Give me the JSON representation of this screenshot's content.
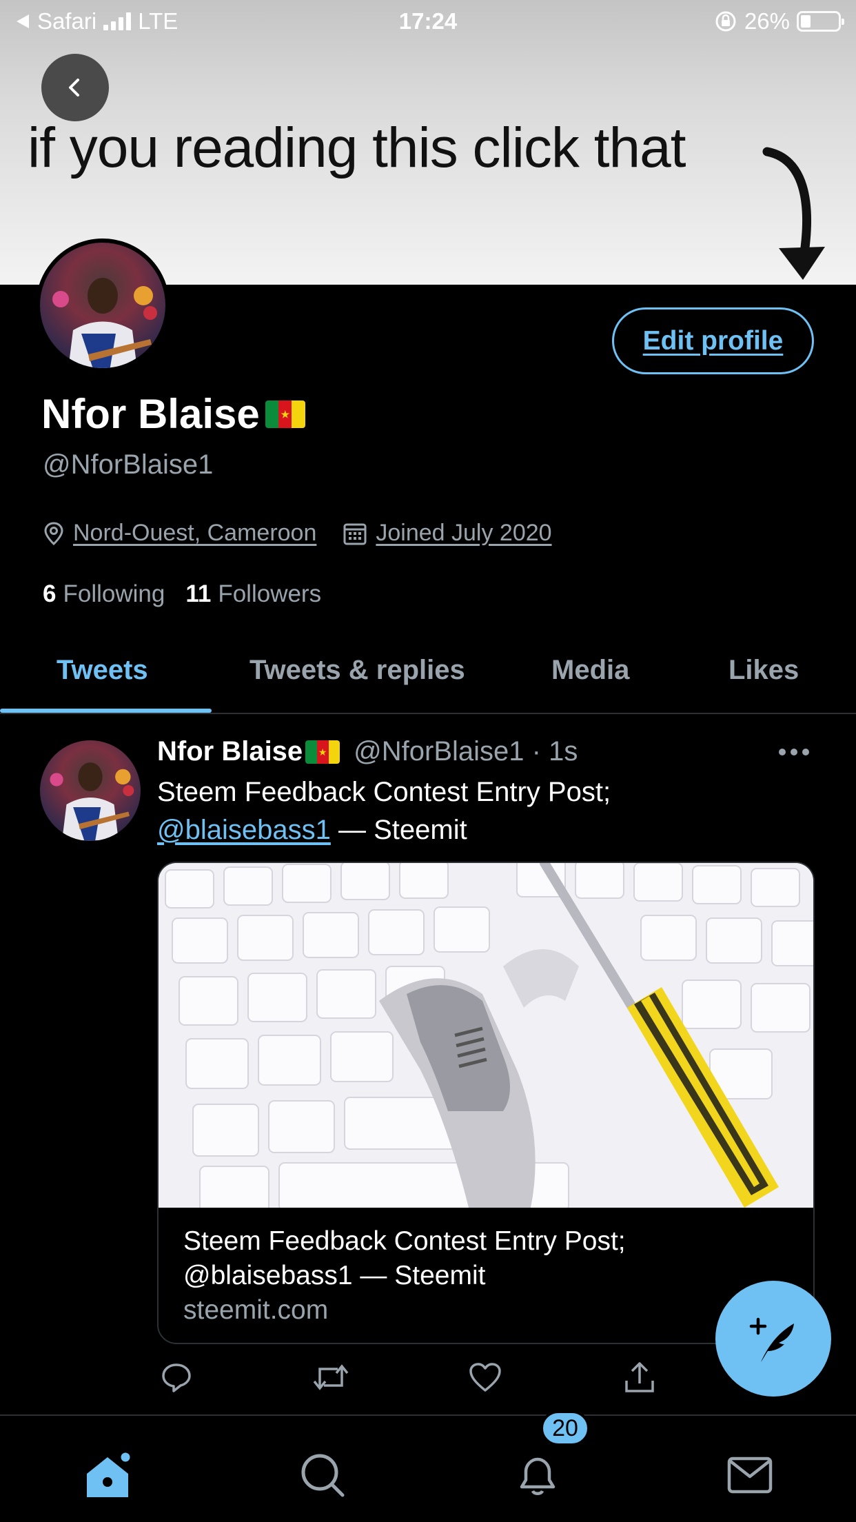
{
  "status_bar": {
    "back_app": "Safari",
    "network": "LTE",
    "time": "17:24",
    "battery": "26%",
    "battery_level": 0.26
  },
  "banner": {
    "text": "if you reading this click that"
  },
  "profile": {
    "edit_label": "Edit profile",
    "name": "Nfor Blaise",
    "handle": "@NforBlaise1",
    "location": "Nord-Ouest, Cameroon",
    "joined": "Joined July 2020",
    "following_count": "6",
    "following_label": "Following",
    "followers_count": "11",
    "followers_label": "Followers"
  },
  "tabs": [
    {
      "label": "Tweets",
      "active": true
    },
    {
      "label": "Tweets & replies",
      "active": false
    },
    {
      "label": "Media",
      "active": false
    },
    {
      "label": "Likes",
      "active": false
    }
  ],
  "tweet": {
    "name": "Nfor Blaise",
    "meta": "@NforBlaise1 · 1s",
    "text_line1": "Steem Feedback Contest Entry Post;",
    "mention": "@blaisebass1",
    "text_suffix": " — Steemit",
    "card_title_line1": "Steem Feedback Contest Entry Post;",
    "card_title_line2": "@blaisebass1 — Steemit",
    "card_domain": "steemit.com"
  },
  "nav": {
    "notifications_badge": "20"
  },
  "colors": {
    "accent": "#6fc1f4",
    "muted": "#9aa4ad",
    "background": "#000000"
  },
  "icons": [
    "back-icon",
    "location-icon",
    "calendar-icon",
    "more-icon",
    "reply-icon",
    "retweet-icon",
    "like-icon",
    "share-icon",
    "compose-icon",
    "home-icon",
    "search-icon",
    "notifications-icon",
    "messages-icon"
  ]
}
